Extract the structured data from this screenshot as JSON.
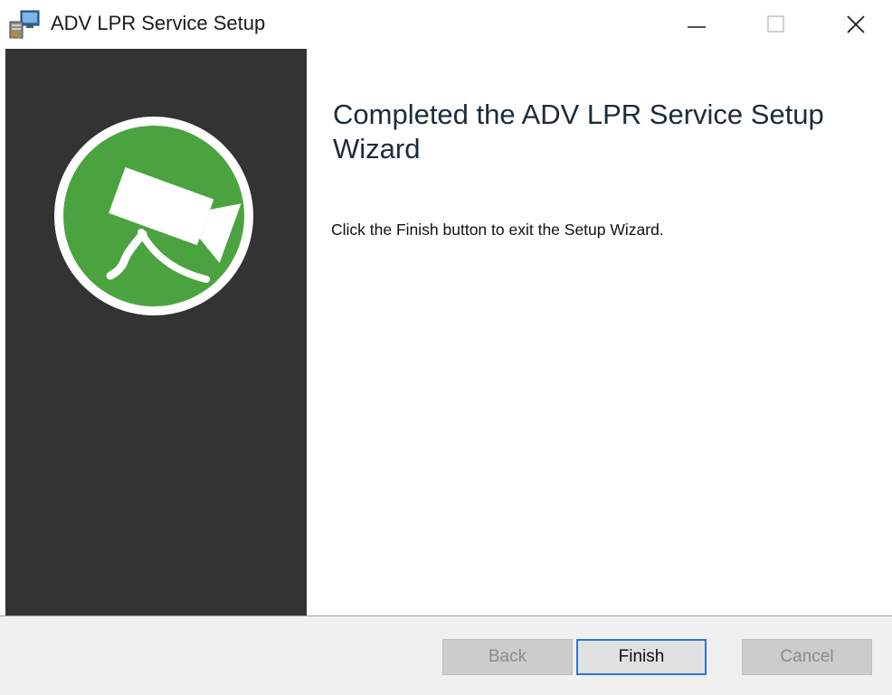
{
  "window": {
    "title": "ADV LPR Service Setup",
    "controls": {
      "minimize_icon": "minimize-icon",
      "maximize_icon": "maximize-icon",
      "close_icon": "close-icon"
    }
  },
  "banner": {
    "logo_icon": "security-camera-icon",
    "background_color": "#333333",
    "logo_color": "#4aa33f"
  },
  "content": {
    "heading": "Completed the ADV LPR Service Setup Wizard",
    "body": "Click the Finish button to exit the Setup Wizard."
  },
  "buttons": {
    "back": "Back",
    "finish": "Finish",
    "cancel": "Cancel",
    "back_enabled": false,
    "finish_enabled": true,
    "cancel_enabled": false
  },
  "colors": {
    "accent_focus": "#2a78d4"
  }
}
